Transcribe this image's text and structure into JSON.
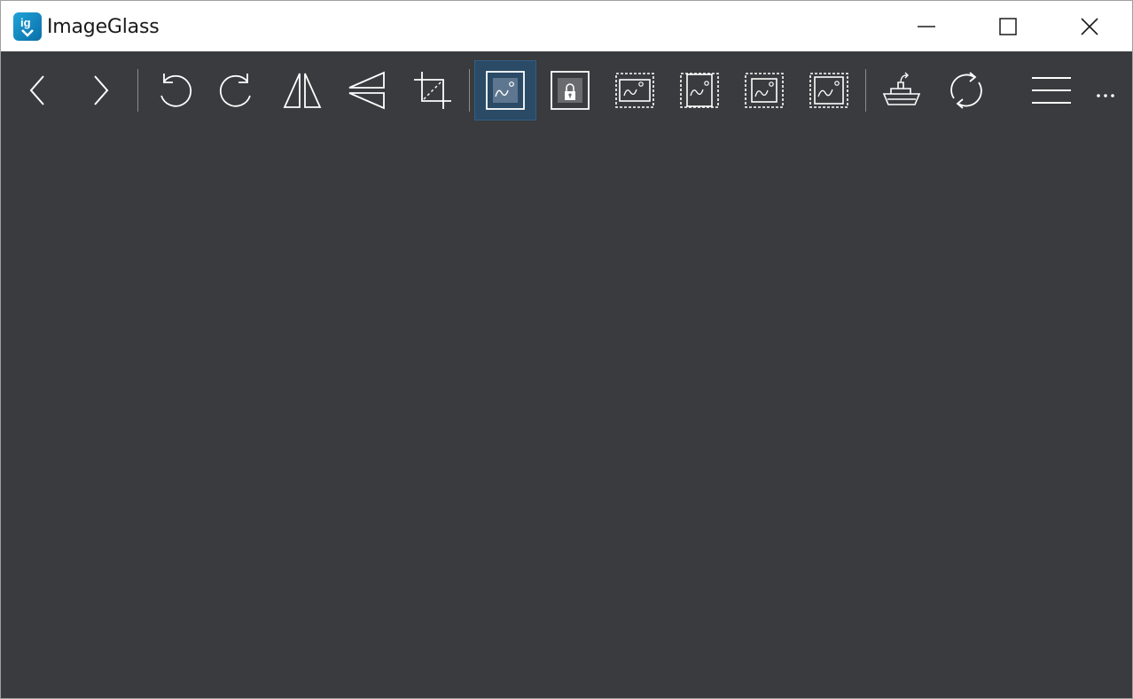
{
  "app": {
    "title": "ImageGlass",
    "icon": "imageglass-logo-icon",
    "accent_color": "#1fa3d8"
  },
  "window_controls": {
    "minimize": "minimize-icon",
    "maximize": "maximize-icon",
    "close": "close-icon"
  },
  "toolbar": {
    "background": "#3a3b3e",
    "active_color": "#2a4a66",
    "buttons": [
      {
        "name": "previous-image-button",
        "icon": "chevron-left-icon"
      },
      {
        "name": "next-image-button",
        "icon": "chevron-right-icon"
      },
      {
        "name": "rotate-left-button",
        "icon": "rotate-left-icon"
      },
      {
        "name": "rotate-right-button",
        "icon": "rotate-right-icon"
      },
      {
        "name": "flip-horizontal-button",
        "icon": "flip-horizontal-icon"
      },
      {
        "name": "flip-vertical-button",
        "icon": "flip-vertical-icon"
      },
      {
        "name": "crop-button",
        "icon": "crop-icon"
      },
      {
        "name": "auto-zoom-button",
        "icon": "auto-zoom-icon",
        "active": true
      },
      {
        "name": "lock-zoom-button",
        "icon": "lock-zoom-icon"
      },
      {
        "name": "scale-to-width-button",
        "icon": "scale-to-width-icon"
      },
      {
        "name": "scale-to-height-button",
        "icon": "scale-to-height-icon"
      },
      {
        "name": "scale-to-fit-button",
        "icon": "scale-to-fit-icon"
      },
      {
        "name": "scale-to-fill-button",
        "icon": "scale-to-fill-icon"
      },
      {
        "name": "open-with-button",
        "icon": "boat-icon"
      },
      {
        "name": "refresh-button",
        "icon": "refresh-icon"
      },
      {
        "name": "main-menu-button",
        "icon": "hamburger-menu-icon"
      },
      {
        "name": "more-button",
        "icon": "ellipsis-icon"
      }
    ]
  }
}
